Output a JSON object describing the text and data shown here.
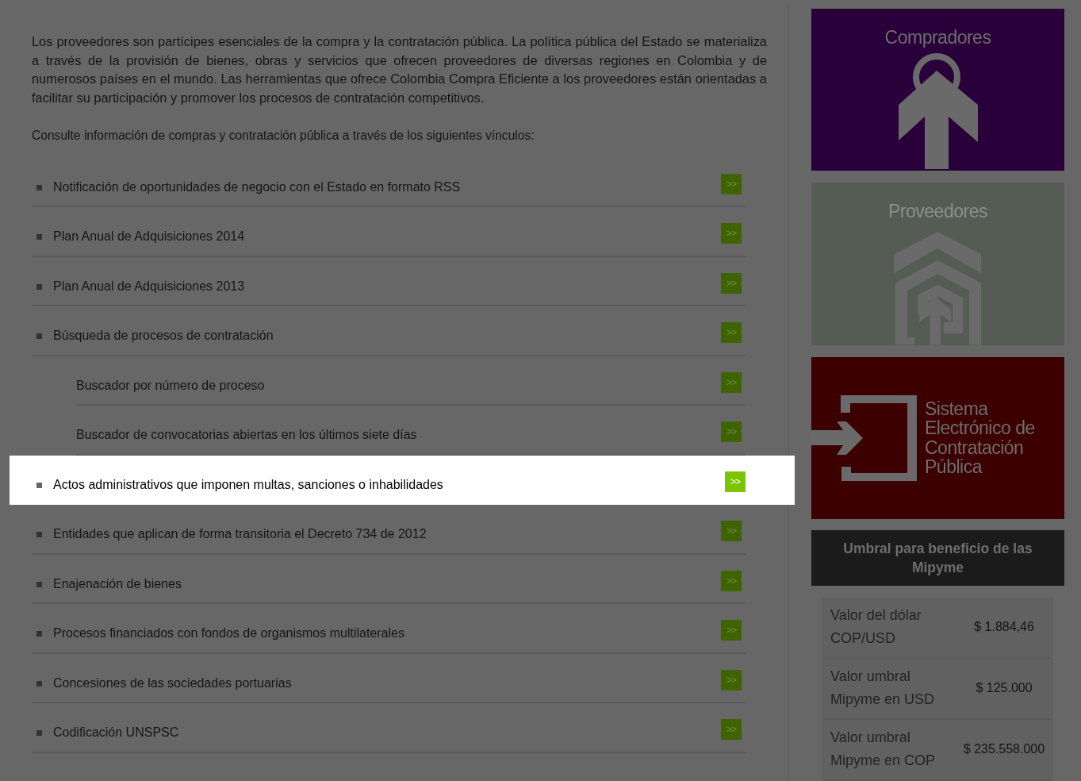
{
  "intro": "Los proveedores son partícipes esenciales de la compra y la contratación pública. La política pública del Estado se materializa a través de la provisión de bienes, obras y servicios que ofrecen proveedores de diversas regiones en Colombia y de numerosos países en el mundo. Las herramientas que ofrece Colombia Compra Eficiente a los proveedores están orientadas a facilitar su participación y promover los procesos de contratación competitivos.",
  "lead": "Consulte información de compras y contratación pública a través de los siguientes vínculos:",
  "links": [
    {
      "label": "Notificación de oportunidades de negocio con el Estado en formato RSS",
      "button": ">>",
      "selected": false
    },
    {
      "label": "Plan Anual de Adquisiciones 2014",
      "button": ">>",
      "selected": false
    },
    {
      "label": "Plan Anual de Adquisiciones 2013",
      "button": ">>",
      "selected": false
    },
    {
      "label": "Búsqueda de procesos de contratación",
      "button": ">>",
      "selected": false,
      "children": [
        {
          "label": "Buscador por número de proceso",
          "button": ">>",
          "selected": false
        },
        {
          "label": "Buscador de convocatorias abiertas en los últimos siete días",
          "button": ">>",
          "selected": false
        }
      ]
    },
    {
      "label": "Actos administrativos que imponen multas, sanciones o inhabilidades",
      "button": ">>",
      "selected": true
    },
    {
      "label": "Entidades que aplican de forma transitoria el Decreto 734 de 2012",
      "button": ">>",
      "selected": false
    },
    {
      "label": "Enajenación de bienes",
      "button": ">>",
      "selected": false
    },
    {
      "label": "Procesos financiados con fondos de organismos multilaterales",
      "button": ">>",
      "selected": false
    },
    {
      "label": "Concesiones de las sociedades portuarias",
      "button": ">>",
      "selected": false
    },
    {
      "label": "Codificación UNSPSC",
      "button": ">>",
      "selected": false
    }
  ],
  "sidebar": {
    "cards": [
      {
        "kind": "buyers",
        "title": "Compradores",
        "color": "#2a003a"
      },
      {
        "kind": "suppliers",
        "title": "Proveedores",
        "color": "#545c54"
      },
      {
        "kind": "system",
        "title": "Sistema Electrónico de Contratación Pública",
        "color": "#3c0000"
      }
    ],
    "mipyme": {
      "title": "Umbral para beneficio de las Mipyme",
      "rows": [
        {
          "label": "Valor del dólar COP/USD",
          "value": "$ 1.884,46"
        },
        {
          "label": "Valor umbral Mipyme en USD",
          "value": "$ 125.000"
        },
        {
          "label": "Valor umbral Mipyme en COP",
          "value": "$ 235.558.000"
        }
      ]
    }
  }
}
